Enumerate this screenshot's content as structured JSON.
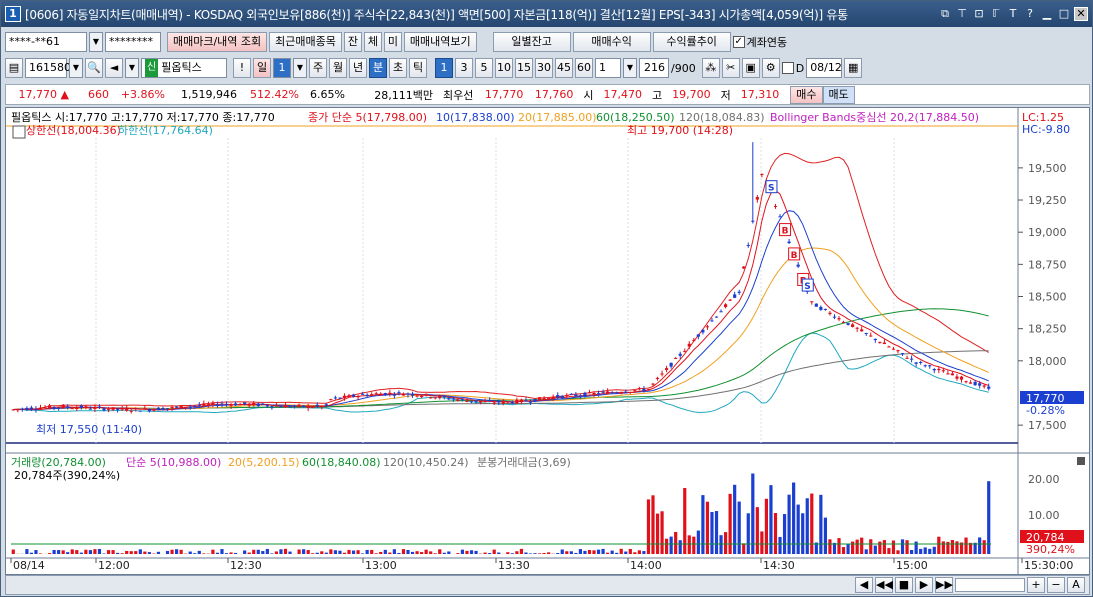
{
  "window": {
    "badge": "1",
    "title": "[0606] 자동일지차트(매매내역) - KOSDAQ 외국인보유[886(천)] 주식수[22,843(천)] 액면[500] 자본금[118(억)] 결산[12월] EPS[-343] 시가총액[4,059(억)] 유통",
    "icons": [
      "⧉",
      "⊤",
      "⊡",
      "ℾ",
      "T",
      "?"
    ]
  },
  "toolbar1": {
    "account": "****-**61",
    "password": "********",
    "buttons": [
      "매매마크/내역 조회",
      "최근매매종목",
      "잔",
      "체",
      "미",
      "매매내역보기"
    ],
    "buttons_right": [
      "일별잔고",
      "매매수익",
      "수익률추이"
    ],
    "check_label": "계좌연동"
  },
  "toolbar2": {
    "code": "161580",
    "badge": "신",
    "stock_name": "필옵틱스",
    "period_day": "일",
    "period_num": "1",
    "periods": [
      "주",
      "월",
      "년"
    ],
    "minute_tabs": [
      "분",
      "초",
      "틱"
    ],
    "minute_values": [
      "1",
      "3",
      "5",
      "10",
      "15",
      "30",
      "45",
      "60"
    ],
    "interval": "1",
    "count": "216",
    "count_total": "/900",
    "d_label": "D",
    "date": "08/12"
  },
  "quote": {
    "price": "17,770",
    "arrow": "▲",
    "change": "660",
    "change_pct": "+3.86%",
    "volume": "1,519,946",
    "vol_pct": "512.42%",
    "turnover": "6.65%",
    "amount": "28,111백만",
    "priority_label": "최우선",
    "ask": "17,770",
    "bid": "17,760",
    "open_label": "시",
    "open": "17,470",
    "high_label": "고",
    "high": "19,700",
    "low_label": "저",
    "low": "17,310",
    "buy_label": "매수",
    "sell_label": "매도"
  },
  "chart": {
    "legend": "필옵틱스 시:17,770 고:17,770 저:17,770 종:17,770",
    "ma_label": "종가 단순 5(17,798.00)",
    "ma10": "10(17,838.00)",
    "ma20": "20(17,885.00)",
    "ma60": "60(18,250.50)",
    "ma120": "120(18,084.83)",
    "bb_label": "Bollinger Bands중심선 20,2(17,884.50)",
    "upper_label": "상한선(18,004.36)",
    "lower_label": "하한선(17,764.64)",
    "lc": "LC:1.25",
    "hc": "HC:-9.80",
    "high_note": "최고 19,700 (14:28)",
    "low_note": "최저 17,550 (11:40)",
    "last_price": "17,770",
    "last_pct": "-0.28%",
    "price_ticks": [
      "19,500",
      "19,250",
      "19,000",
      "18,750",
      "18,500",
      "18,250",
      "18,000",
      "17,500"
    ],
    "vol_legend": "거래량(20,784.00)",
    "vol_ma5": "단순 5(10,988.00)",
    "vol_ma20": "20(5,200.15)",
    "vol_ma60": "60(18,840.08)",
    "vol_ma120": "120(10,450.24)",
    "vol_amount": "분봉거래대금(3,69)",
    "vol_sub": "20,784주(390,24%)",
    "vol_ticks": [
      "20.00",
      "10.00"
    ],
    "vol_last": "20,784",
    "vol_last_pct": "390,24%",
    "time_labels": [
      "08/14",
      "12:00",
      "12:30",
      "13:00",
      "13:30",
      "14:00",
      "14:30",
      "15:00",
      "15:30:00"
    ],
    "trade_marks": [
      "S",
      "B",
      "B",
      "B",
      "S"
    ]
  },
  "statusbar": {
    "icons": [
      "◀",
      "◀◀",
      "■",
      "▶",
      "▶▶",
      "+",
      "−",
      "A"
    ]
  },
  "colors": {
    "up": "#e0111b",
    "down": "#1b3fd0",
    "ma5": "#e0111b",
    "ma10": "#1b3fd0",
    "ma20": "#f0a020",
    "ma60": "#109030",
    "ma120": "#707070",
    "bb": "#e02020",
    "bb_lower": "#20a8c0"
  }
}
